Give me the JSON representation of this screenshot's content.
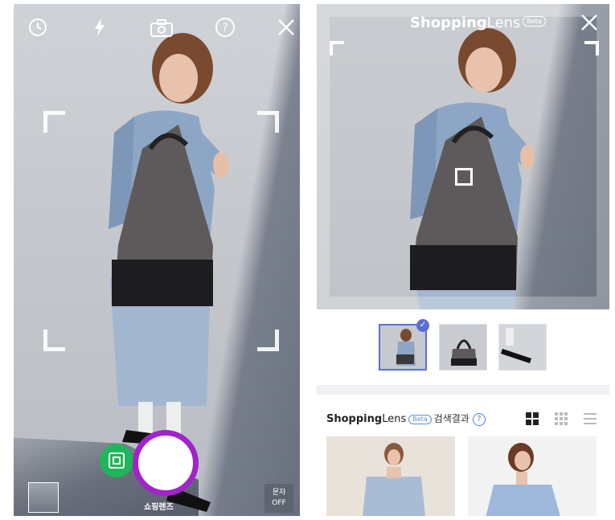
{
  "camera": {
    "icons": [
      "timer-icon",
      "flash-icon",
      "camera-switch-icon",
      "help-icon",
      "close-icon"
    ],
    "modes": {
      "inactive_label": "",
      "active_label": "쇼핑렌즈"
    },
    "text_toggle": {
      "line1": "문자",
      "line2": "OFF"
    },
    "accent_color": "#a223c9",
    "shot_button_color": "#1fb65b"
  },
  "results": {
    "brand_bold": "Shopping",
    "brand_light": "Lens",
    "beta_label": "Beta",
    "header_suffix": "검색결과",
    "help_label": "?",
    "thumbnails": [
      {
        "name": "thumbnail-full-outfit",
        "selected": true
      },
      {
        "name": "thumbnail-bag",
        "selected": false
      },
      {
        "name": "thumbnail-shoes",
        "selected": false
      }
    ],
    "check_mark": "✓",
    "view_modes": [
      "grid-large-view-icon",
      "grid-small-view-icon",
      "list-view-icon"
    ],
    "accent_color": "#5b6ed3"
  }
}
